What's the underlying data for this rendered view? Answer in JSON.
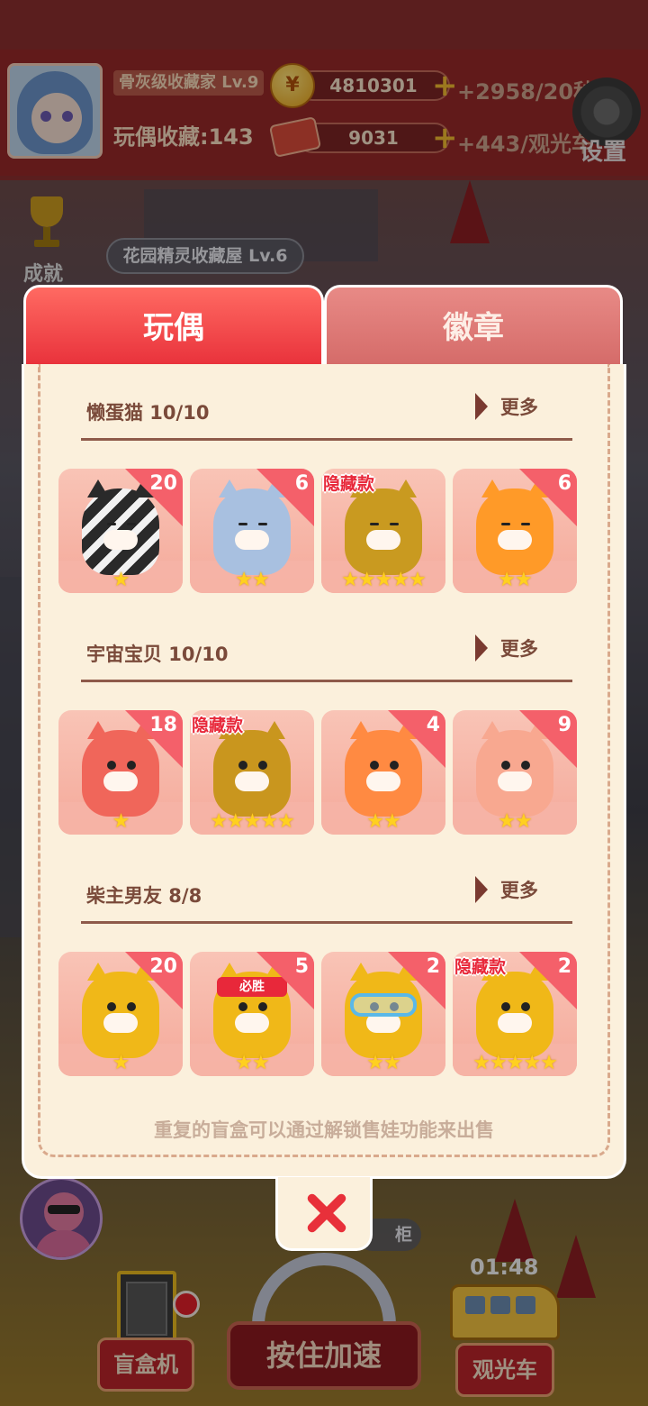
{
  "hud": {
    "rank_title": "骨灰级收藏家 Lv.9",
    "collection_label": "玩偶收藏:143",
    "coins": "4810301",
    "coin_rate": "+2958/20秒",
    "coin_icon_glyph": "¥",
    "tickets": "9031",
    "ticket_rate": "+443/观光车",
    "settings_label": "设置",
    "achievements_label": "成就",
    "house_label": "花园精灵收藏屋 Lv.6"
  },
  "tabs": [
    {
      "label": "玩偶",
      "active": true
    },
    {
      "label": "徽章",
      "active": false
    }
  ],
  "series": [
    {
      "title": "懒蛋猫 10/10",
      "more_label": "更多",
      "cards": [
        {
          "count": "20",
          "hidden_label": "",
          "stars": "★",
          "figure": "cat-black-white",
          "color": "#3a3a3a"
        },
        {
          "count": "6",
          "hidden_label": "",
          "stars": "★★",
          "figure": "cat-blue",
          "color": "#a8c0e0"
        },
        {
          "count": "",
          "hidden_label": "隐藏款",
          "stars": "★★★★★",
          "figure": "cat-gold",
          "color": "#c99a20"
        },
        {
          "count": "6",
          "hidden_label": "",
          "stars": "★★",
          "figure": "cat-orange",
          "color": "#ff9a28"
        }
      ]
    },
    {
      "title": "宇宙宝贝 10/10",
      "more_label": "更多",
      "cards": [
        {
          "count": "18",
          "hidden_label": "",
          "stars": "★",
          "figure": "baby-red",
          "color": "#f0665a"
        },
        {
          "count": "",
          "hidden_label": "隐藏款",
          "stars": "★★★★★",
          "figure": "baby-gold",
          "color": "#c9961e"
        },
        {
          "count": "4",
          "hidden_label": "",
          "stars": "★★",
          "figure": "baby-orange",
          "color": "#ff8a42"
        },
        {
          "count": "9",
          "hidden_label": "",
          "stars": "★★",
          "figure": "baby-peach",
          "color": "#f8a890"
        }
      ]
    },
    {
      "title": "柴主男友 8/8",
      "more_label": "更多",
      "cards": [
        {
          "count": "20",
          "hidden_label": "",
          "stars": "★",
          "figure": "shiba-winking",
          "color": "#f0b818"
        },
        {
          "count": "5",
          "hidden_label": "",
          "stars": "★★",
          "figure": "shiba-headband",
          "color": "#f0b818",
          "tag": "必胜"
        },
        {
          "count": "2",
          "hidden_label": "",
          "stars": "★★",
          "figure": "shiba-snorkel",
          "color": "#f0b818"
        },
        {
          "count": "2",
          "hidden_label": "隐藏款",
          "stars": "★★★★★",
          "figure": "shiba-classic",
          "color": "#f0b818"
        }
      ]
    }
  ],
  "footer_note": "重复的盲盒可以通过解锁售娃功能来出售",
  "bottom": {
    "blindbox_label": "盲盒机",
    "hold_label": "按住加速",
    "train_label": "观光车",
    "timer": "01:48",
    "cabinet_label": "柜"
  },
  "colors": {
    "accent_red": "#e8303a",
    "panel_bg": "#fbf0dc",
    "star": "#ffd020"
  }
}
